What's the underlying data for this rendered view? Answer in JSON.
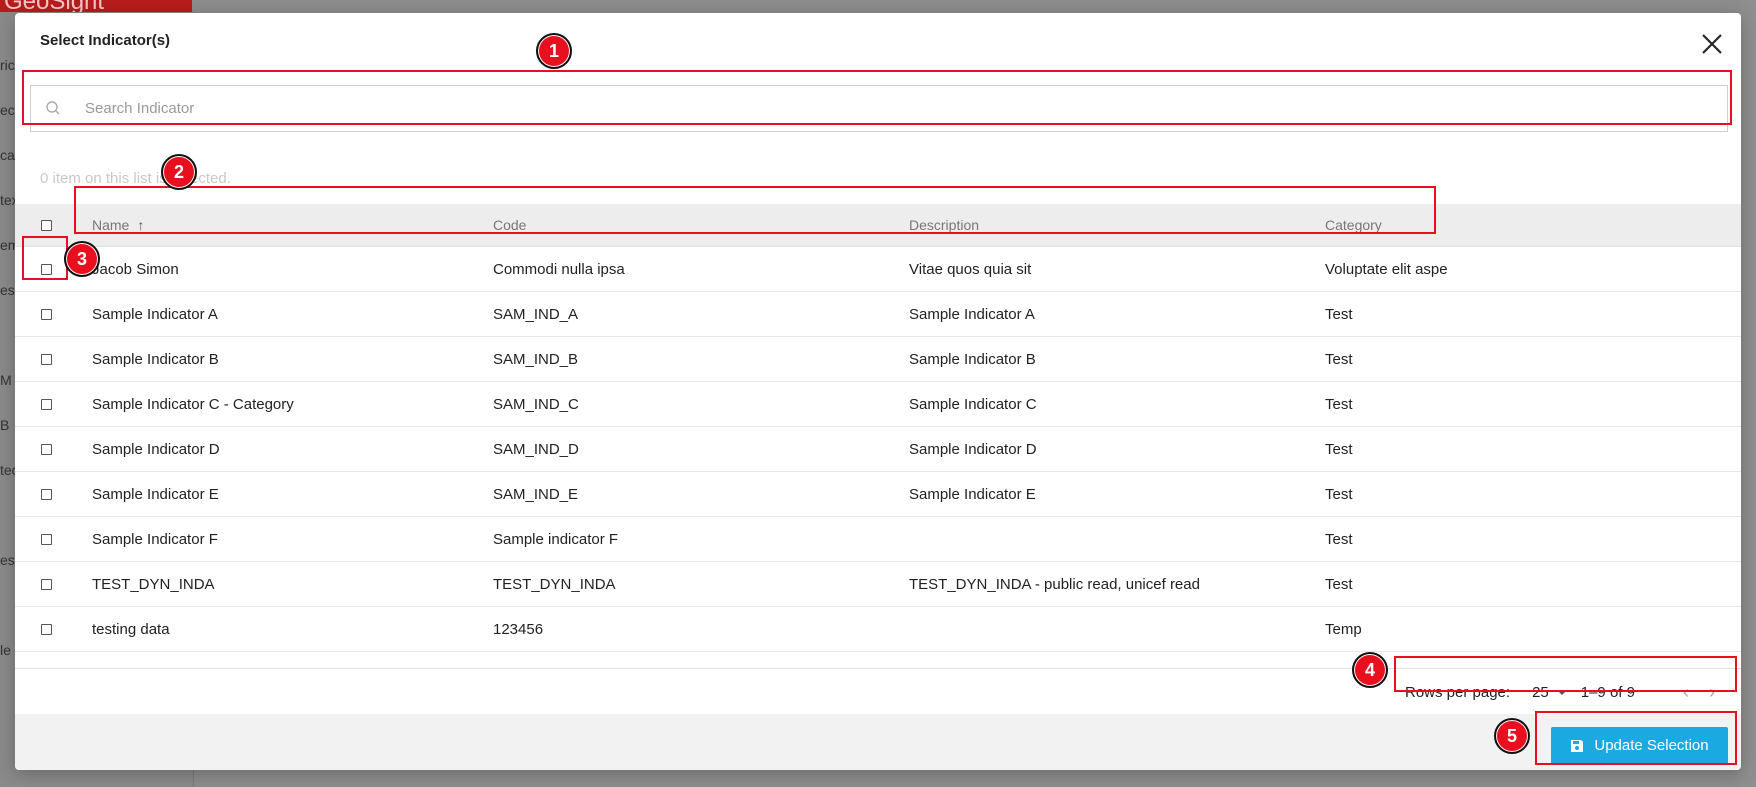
{
  "background": {
    "logo_text": "GeoSight",
    "sidebar_fragments": [
      "ric",
      "ect",
      "cat",
      "tex",
      "em",
      "es",
      "M",
      "B",
      "tec",
      "ess",
      "le"
    ]
  },
  "dialog": {
    "title": "Select Indicator(s)",
    "close_icon": "close-icon"
  },
  "search": {
    "placeholder": "Search Indicator",
    "value": ""
  },
  "selection_info": "0 item on this list is selected.",
  "table": {
    "columns": [
      "Name",
      "Code",
      "Description",
      "Category"
    ],
    "sort": {
      "column": "Name",
      "direction": "ascending"
    },
    "rows": [
      {
        "name": "Jacob Simon",
        "code": "Commodi nulla ipsa",
        "description": "Vitae quos quia sit",
        "category": "Voluptate elit aspe"
      },
      {
        "name": "Sample Indicator A",
        "code": "SAM_IND_A",
        "description": "Sample Indicator A",
        "category": "Test"
      },
      {
        "name": "Sample Indicator B",
        "code": "SAM_IND_B",
        "description": "Sample Indicator B",
        "category": "Test"
      },
      {
        "name": "Sample Indicator C - Category",
        "code": "SAM_IND_C",
        "description": "Sample Indicator C",
        "category": "Test"
      },
      {
        "name": "Sample Indicator D",
        "code": "SAM_IND_D",
        "description": "Sample Indicator D",
        "category": "Test"
      },
      {
        "name": "Sample Indicator E",
        "code": "SAM_IND_E",
        "description": "Sample Indicator E",
        "category": "Test"
      },
      {
        "name": "Sample Indicator F",
        "code": "Sample indicator F",
        "description": "",
        "category": "Test"
      },
      {
        "name": "TEST_DYN_INDA",
        "code": "TEST_DYN_INDA",
        "description": "TEST_DYN_INDA - public read, unicef read",
        "category": "Test"
      },
      {
        "name": "testing data",
        "code": "123456",
        "description": "",
        "category": "Temp"
      }
    ]
  },
  "pagination": {
    "rows_per_page_label": "Rows per page:",
    "rows_per_page": "25",
    "range": "1–9 of 9"
  },
  "footer": {
    "update_label": "Update Selection"
  },
  "annotations": [
    "1",
    "2",
    "3",
    "4",
    "5"
  ],
  "colors": {
    "accent": "#1aa9e0",
    "annotation": "#e8101e",
    "header_bg": "#ededed"
  }
}
